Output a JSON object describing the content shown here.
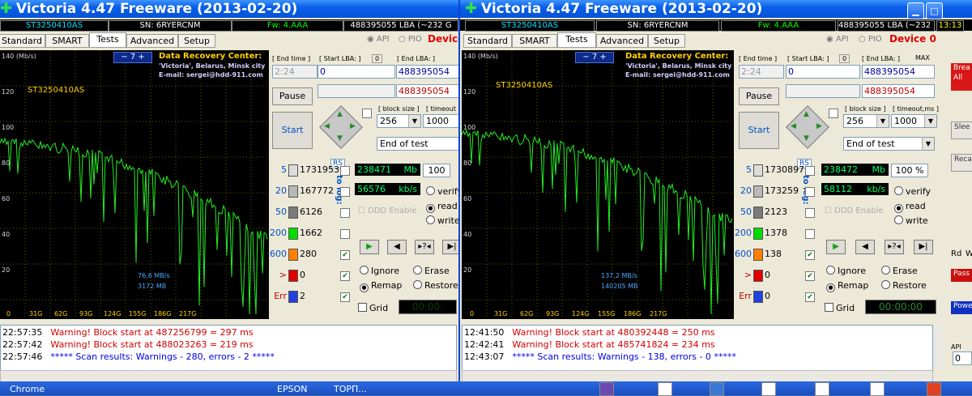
{
  "left": {
    "title": "Victoria 4.47  Freeware (2013-02-20)",
    "info": {
      "model": "ST3250410AS",
      "sn": "SN: 6RYERCNM",
      "fw": "Fw: 4.AAA",
      "lba": "488395055 LBA (~232 G"
    },
    "tabs": [
      "Standard",
      "SMART",
      "Tests",
      "Advanced",
      "Setup"
    ],
    "api": "API",
    "pio": "PIO",
    "device": "Device",
    "graph": {
      "y_labels": [
        "140 (Mb/s)",
        "120",
        "100",
        "80",
        "60",
        "40",
        "20"
      ],
      "x_labels": [
        "0",
        "31G",
        "62G",
        "93G",
        "124G",
        "155G",
        "186G",
        "217G"
      ],
      "model": "ST3250410AS",
      "speed1": "76,6 MB/s",
      "speed2": "3172 MB",
      "spin": "7"
    },
    "drc": {
      "title": "Data Recovery Center:",
      "line1": "'Victoria', Belarus, Minsk city",
      "line2": "E-mail: sergei@hdd-911.com"
    },
    "end_time_label": "[ End time ]",
    "start_lba_label": "[ Start LBA: ]",
    "start_lba_btn": "0",
    "end_lba_label": "[ End LBA: ]",
    "end_time": "2:24",
    "start_lba": "0",
    "end_lba": "488395054",
    "end_lba2": "488395054",
    "pause": "Pause",
    "start": "Start",
    "block_size_label": "[ block size ]",
    "timeout_label": "[ timeout",
    "block_size": "256",
    "timeout": "1000",
    "status": "End of test",
    "rs": "RS",
    "to_log": "to log:",
    "counters": [
      {
        "lbl": "5",
        "val": "1731953",
        "color": "#dcdcdc"
      },
      {
        "lbl": "20",
        "val": "167772",
        "color": "#b8b8b8"
      },
      {
        "lbl": "50",
        "val": "6126",
        "color": "#7a7a7a"
      },
      {
        "lbl": "200",
        "val": "1662",
        "color": "#00dd00"
      },
      {
        "lbl": "600",
        "val": "280",
        "color": "#ff8000"
      },
      {
        "lbl": ">",
        "val": "0",
        "color": "#e00000"
      },
      {
        "lbl": "Err",
        "val": "2",
        "color": "#2040e0"
      }
    ],
    "mb": "238471",
    "mb_unit": "Mb",
    "pct": "100",
    "kbs": "56576",
    "kbs_unit": "kb/s",
    "ddd": "DDD Enable",
    "modes": [
      "verify",
      "read",
      "write"
    ],
    "ignore": "Ignore",
    "erase": "Erase",
    "remap": "Remap",
    "restore": "Restore",
    "grid": "Grid",
    "timer": "00:00:",
    "log": [
      {
        "t": "22:57:35",
        "msg": "Warning! Block start at 487256799 = 297 ms",
        "kind": "w"
      },
      {
        "t": "22:57:42",
        "msg": "Warning! Block start at 488023263 = 219 ms",
        "kind": "w"
      },
      {
        "t": "22:57:46",
        "msg": "***** Scan results: Warnings - 280, errors - 2 *****",
        "kind": "i"
      }
    ]
  },
  "right": {
    "title": "Victoria 4.47  Freeware (2013-02-20)",
    "info": {
      "model": "ST3250410AS",
      "sn": "SN: 6RYERCNM",
      "fw": "Fw: 4.AAA",
      "lba": "488395055 LBA (~232 GB)",
      "time": "13:13"
    },
    "tabs": [
      "Standard",
      "SMART",
      "Tests",
      "Advanced",
      "Setup"
    ],
    "api": "API",
    "pio": "PIO",
    "device": "Device 0",
    "graph": {
      "y_labels": [
        "140 (Mb/s)",
        "120",
        "100",
        "80",
        "60",
        "40",
        "20"
      ],
      "x_labels": [
        "0",
        "31G",
        "62G",
        "93G",
        "124G",
        "155G",
        "186G",
        "217G"
      ],
      "model": "ST3250410AS",
      "speed1": "137,2 MB/s",
      "speed2": "140205 MB",
      "spin": "7"
    },
    "drc": {
      "title": "Data Recovery Center:",
      "line1": "'Victoria', Belarus, Minsk city",
      "line2": "E-mail: sergei@hdd-911.com"
    },
    "end_time_label": "[ End time ]",
    "start_lba_label": "[ Start LBA: ]",
    "start_lba_btn": "0",
    "end_lba_label": "[ End LBA: ]",
    "max": "MAX",
    "end_time": "2:24",
    "start_lba": "0",
    "end_lba": "488395054",
    "end_lba2": "488395054",
    "pause": "Pause",
    "start": "Start",
    "block_size_label": "[ block size ]",
    "timeout_label": "[ timeout,ms ]",
    "block_size": "256",
    "timeout": "1000",
    "status": "End of test",
    "rs": "RS",
    "to_log": "to log:",
    "counters": [
      {
        "lbl": "5",
        "val": "1730897",
        "color": "#dcdcdc"
      },
      {
        "lbl": "20",
        "val": "173259",
        "color": "#b8b8b8"
      },
      {
        "lbl": "50",
        "val": "2123",
        "color": "#7a7a7a"
      },
      {
        "lbl": "200",
        "val": "1378",
        "color": "#00dd00"
      },
      {
        "lbl": "600",
        "val": "138",
        "color": "#ff8000"
      },
      {
        "lbl": ">",
        "val": "0",
        "color": "#e00000"
      },
      {
        "lbl": "Err",
        "val": "0",
        "color": "#2040e0"
      }
    ],
    "mb": "238472",
    "mb_unit": "Mb",
    "pct": "100",
    "pct_unit": "%",
    "kbs": "58112",
    "kbs_unit": "kb/s",
    "ddd": "DDD Enable",
    "modes": [
      "verify",
      "read",
      "write"
    ],
    "ignore": "Ignore",
    "erase": "Erase",
    "remap": "Remap",
    "restore": "Restore",
    "grid": "Grid",
    "timer": "00:00:00",
    "log": [
      {
        "t": "12:41:50",
        "msg": "Warning! Block start at 480392448 = 250 ms",
        "kind": "w"
      },
      {
        "t": "12:42:41",
        "msg": "Warning! Block start at 485741824 = 234 ms",
        "kind": "w"
      },
      {
        "t": "12:43:07",
        "msg": "***** Scan results: Warnings - 138, errors - 0 *****",
        "kind": "i"
      }
    ],
    "side": {
      "break": "Brea All",
      "sleep": "Slee",
      "recal": "Reca",
      "rd": "Rd",
      "wr": "W",
      "passp": "Pass",
      "power": "Powe",
      "api_small": "API",
      "zero": "0"
    }
  },
  "taskbar": {
    "chrome": "Chrome",
    "epson": "EPSON",
    "item3": "ТОРП..."
  }
}
